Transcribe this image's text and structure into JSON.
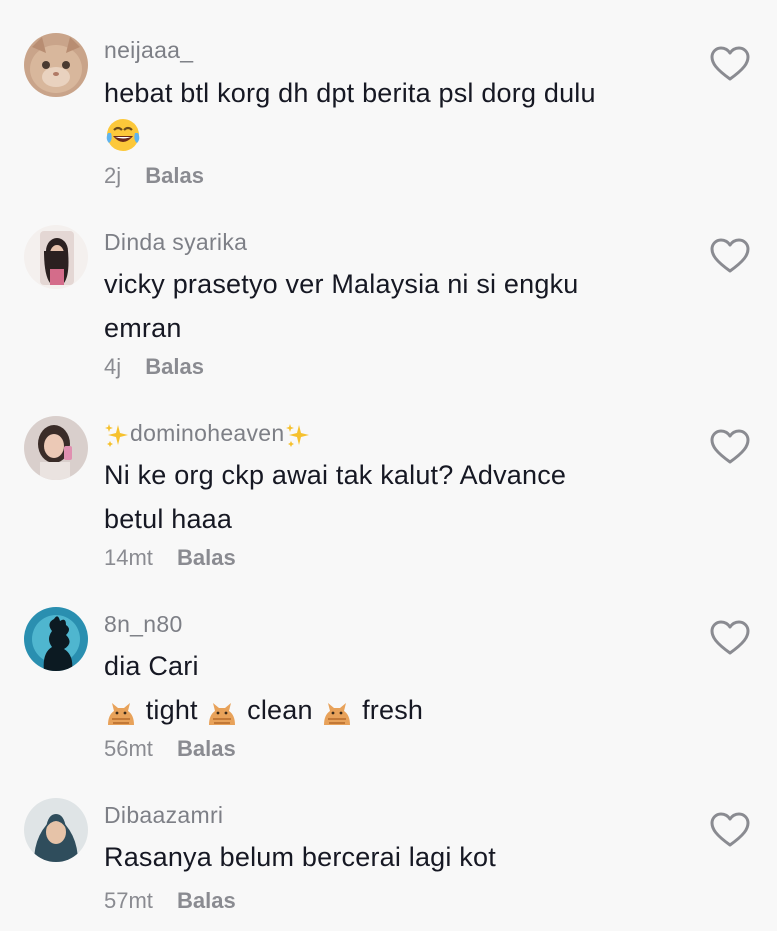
{
  "comments": [
    {
      "username": "neijaaa_",
      "lines": [
        "hebat btl korg dh dpt berita psl dorg dulu"
      ],
      "emoji": "face-with-tears-of-joy-icon",
      "time": "2j",
      "reply_label": "Balas"
    },
    {
      "username": "Dinda syarika",
      "lines": [
        "vicky prasetyo ver Malaysia ni si engku",
        "emran"
      ],
      "time": "4j",
      "reply_label": "Balas"
    },
    {
      "username": "dominoheaven",
      "username_decoration": "sparkles-icon",
      "lines": [
        "Ni ke org ckp awai tak kalut? Advance",
        "betul haaa"
      ],
      "time": "14mt",
      "reply_label": "Balas"
    },
    {
      "username": "8n_n80",
      "lines": [
        "dia Cari"
      ],
      "cat_line": {
        "icon": "cat-icon",
        "words": [
          "tight",
          "clean",
          "fresh"
        ]
      },
      "time": "56mt",
      "reply_label": "Balas"
    },
    {
      "username": "Dibaazamri",
      "lines": [
        "Rasanya belum bercerai lagi kot"
      ],
      "time": "57mt",
      "reply_label": "Balas"
    }
  ],
  "colors": {
    "background": "#f8f8f8",
    "text": "#161823",
    "username": "#7d7f86",
    "meta": "#8a8b91",
    "heart_outline": "#8a8b91"
  }
}
